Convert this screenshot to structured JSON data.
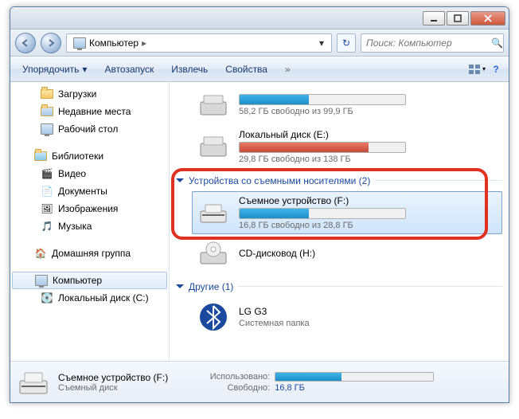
{
  "breadcrumb": {
    "root_label": "Компьютер"
  },
  "search": {
    "placeholder": "Поиск: Компьютер"
  },
  "toolbar": {
    "organize": "Упорядочить",
    "autoplay": "Автозапуск",
    "eject": "Извлечь",
    "properties": "Свойства"
  },
  "sidebar": {
    "downloads": "Загрузки",
    "recent": "Недавние места",
    "desktop": "Рабочий стол",
    "libraries": "Библиотеки",
    "video": "Видео",
    "documents": "Документы",
    "pictures": "Изображения",
    "music": "Музыка",
    "homegroup": "Домашняя группа",
    "computer": "Компьютер",
    "local_c": "Локальный диск (C:)"
  },
  "drives": {
    "top_free": "58,2 ГБ свободно из 99,9 ГБ",
    "e_name": "Локальный диск (E:)",
    "e_free": "29,8 ГБ свободно из 138 ГБ",
    "removable_group": "Устройства со съемными носителями (2)",
    "f_name": "Съемное устройство (F:)",
    "f_free": "16,8 ГБ свободно из 28,8 ГБ",
    "cd_name": "CD-дисковод (H:)",
    "other_group": "Другие (1)",
    "lg_name": "LG G3",
    "lg_sub": "Системная папка"
  },
  "details": {
    "title": "Съемное устройство (F:)",
    "subtitle": "Съемный диск",
    "used_label": "Использовано:",
    "free_label": "Свободно:",
    "free_value": "16,8 ГБ"
  }
}
